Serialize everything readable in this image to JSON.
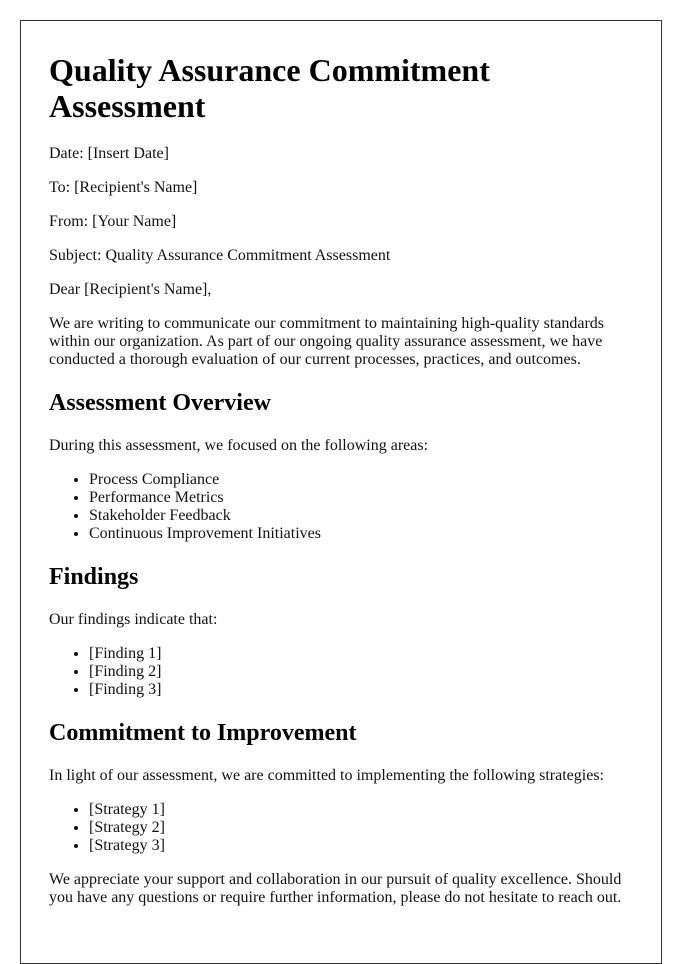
{
  "document": {
    "title": "Quality Assurance Commitment Assessment",
    "header_fields": {
      "date": "Date: [Insert Date]",
      "to": "To: [Recipient's Name]",
      "from": "From: [Your Name]",
      "subject": "Subject: Quality Assurance Commitment Assessment"
    },
    "salutation": "Dear [Recipient's Name],",
    "intro": "We are writing to communicate our commitment to maintaining high-quality standards within our organization. As part of our ongoing quality assurance assessment, we have conducted a thorough evaluation of our current processes, practices, and outcomes.",
    "sections": [
      {
        "heading": "Assessment Overview",
        "lead": "During this assessment, we focused on the following areas:",
        "items": [
          "Process Compliance",
          "Performance Metrics",
          "Stakeholder Feedback",
          "Continuous Improvement Initiatives"
        ]
      },
      {
        "heading": "Findings",
        "lead": "Our findings indicate that:",
        "items": [
          "[Finding 1]",
          "[Finding 2]",
          "[Finding 3]"
        ]
      },
      {
        "heading": "Commitment to Improvement",
        "lead": "In light of our assessment, we are committed to implementing the following strategies:",
        "items": [
          "[Strategy 1]",
          "[Strategy 2]",
          "[Strategy 3]"
        ]
      }
    ],
    "closing": "We appreciate your support and collaboration in our pursuit of quality excellence. Should you have any questions or require further information, please do not hesitate to reach out."
  }
}
